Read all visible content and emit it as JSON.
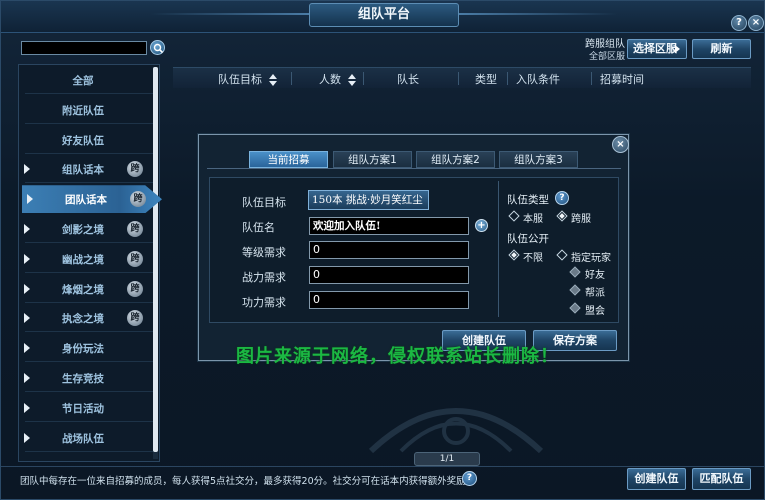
{
  "window": {
    "title": "组队平台"
  },
  "header_buttons": {
    "help": "?",
    "close": "×"
  },
  "search": {
    "value": "",
    "placeholder": ""
  },
  "top_right": {
    "cross_server_label": "跨服组队",
    "cross_server_sub": "全部区服",
    "select_server_button": "选择区服",
    "refresh_button": "刷新"
  },
  "sidebar": {
    "items": [
      {
        "label": "全部",
        "arrow": false,
        "kua": ""
      },
      {
        "label": "附近队伍",
        "arrow": false,
        "kua": ""
      },
      {
        "label": "好友队伍",
        "arrow": false,
        "kua": ""
      },
      {
        "label": "组队话本",
        "arrow": true,
        "kua": "跨"
      },
      {
        "label": "团队话本",
        "arrow": true,
        "kua": "跨",
        "active": true
      },
      {
        "label": "剑影之境",
        "arrow": true,
        "kua": "跨"
      },
      {
        "label": "幽战之境",
        "arrow": true,
        "kua": "跨"
      },
      {
        "label": "烽烟之境",
        "arrow": true,
        "kua": "跨"
      },
      {
        "label": "执念之境",
        "arrow": true,
        "kua": "跨"
      },
      {
        "label": "身份玩法",
        "arrow": true,
        "kua": ""
      },
      {
        "label": "生存竞技",
        "arrow": true,
        "kua": ""
      },
      {
        "label": "节日活动",
        "arrow": true,
        "kua": ""
      },
      {
        "label": "战场队伍",
        "arrow": true,
        "kua": ""
      }
    ]
  },
  "table": {
    "columns": [
      "队伍目标",
      "人数",
      "队长",
      "类型",
      "入队条件",
      "招募时间"
    ]
  },
  "dialog": {
    "close": "×",
    "tabs": [
      "当前招募",
      "组队方案1",
      "组队方案2",
      "组队方案3"
    ],
    "form": {
      "target_label": "队伍目标",
      "target_value": "150本 挑战·妙月笑红尘",
      "name_label": "队伍名",
      "name_value": "欢迎加入队伍!",
      "add": "+",
      "level_label": "等级需求",
      "level_value": "0",
      "power_label": "战力需求",
      "power_value": "0",
      "merit_label": "功力需求",
      "merit_value": "0"
    },
    "team_type": {
      "label": "队伍类型",
      "help": "?",
      "options": [
        {
          "label": "本服",
          "checked": false
        },
        {
          "label": "跨服",
          "checked": true
        }
      ]
    },
    "team_public": {
      "label": "队伍公开",
      "options": [
        {
          "label": "不限",
          "checked": true
        },
        {
          "label": "指定玩家",
          "checked": false
        }
      ],
      "sub_options": [
        "好友",
        "帮派",
        "盟会"
      ]
    },
    "create_button": "创建队伍",
    "save_button": "保存方案"
  },
  "watermark": "图片来源于网络，侵权联系站长删除！",
  "pager": "1/1",
  "footer": {
    "text": "团队中每存在一位来自招募的成员，每人获得5点社交分，最多获得20分。社交分可在话本内获得额外奖励。",
    "help": "?",
    "create_button": "创建队伍",
    "match_button": "匹配队伍"
  },
  "colors": {
    "accent": "#3c7fb5",
    "background": "#0c1a29",
    "watermark": "#1bb843"
  }
}
